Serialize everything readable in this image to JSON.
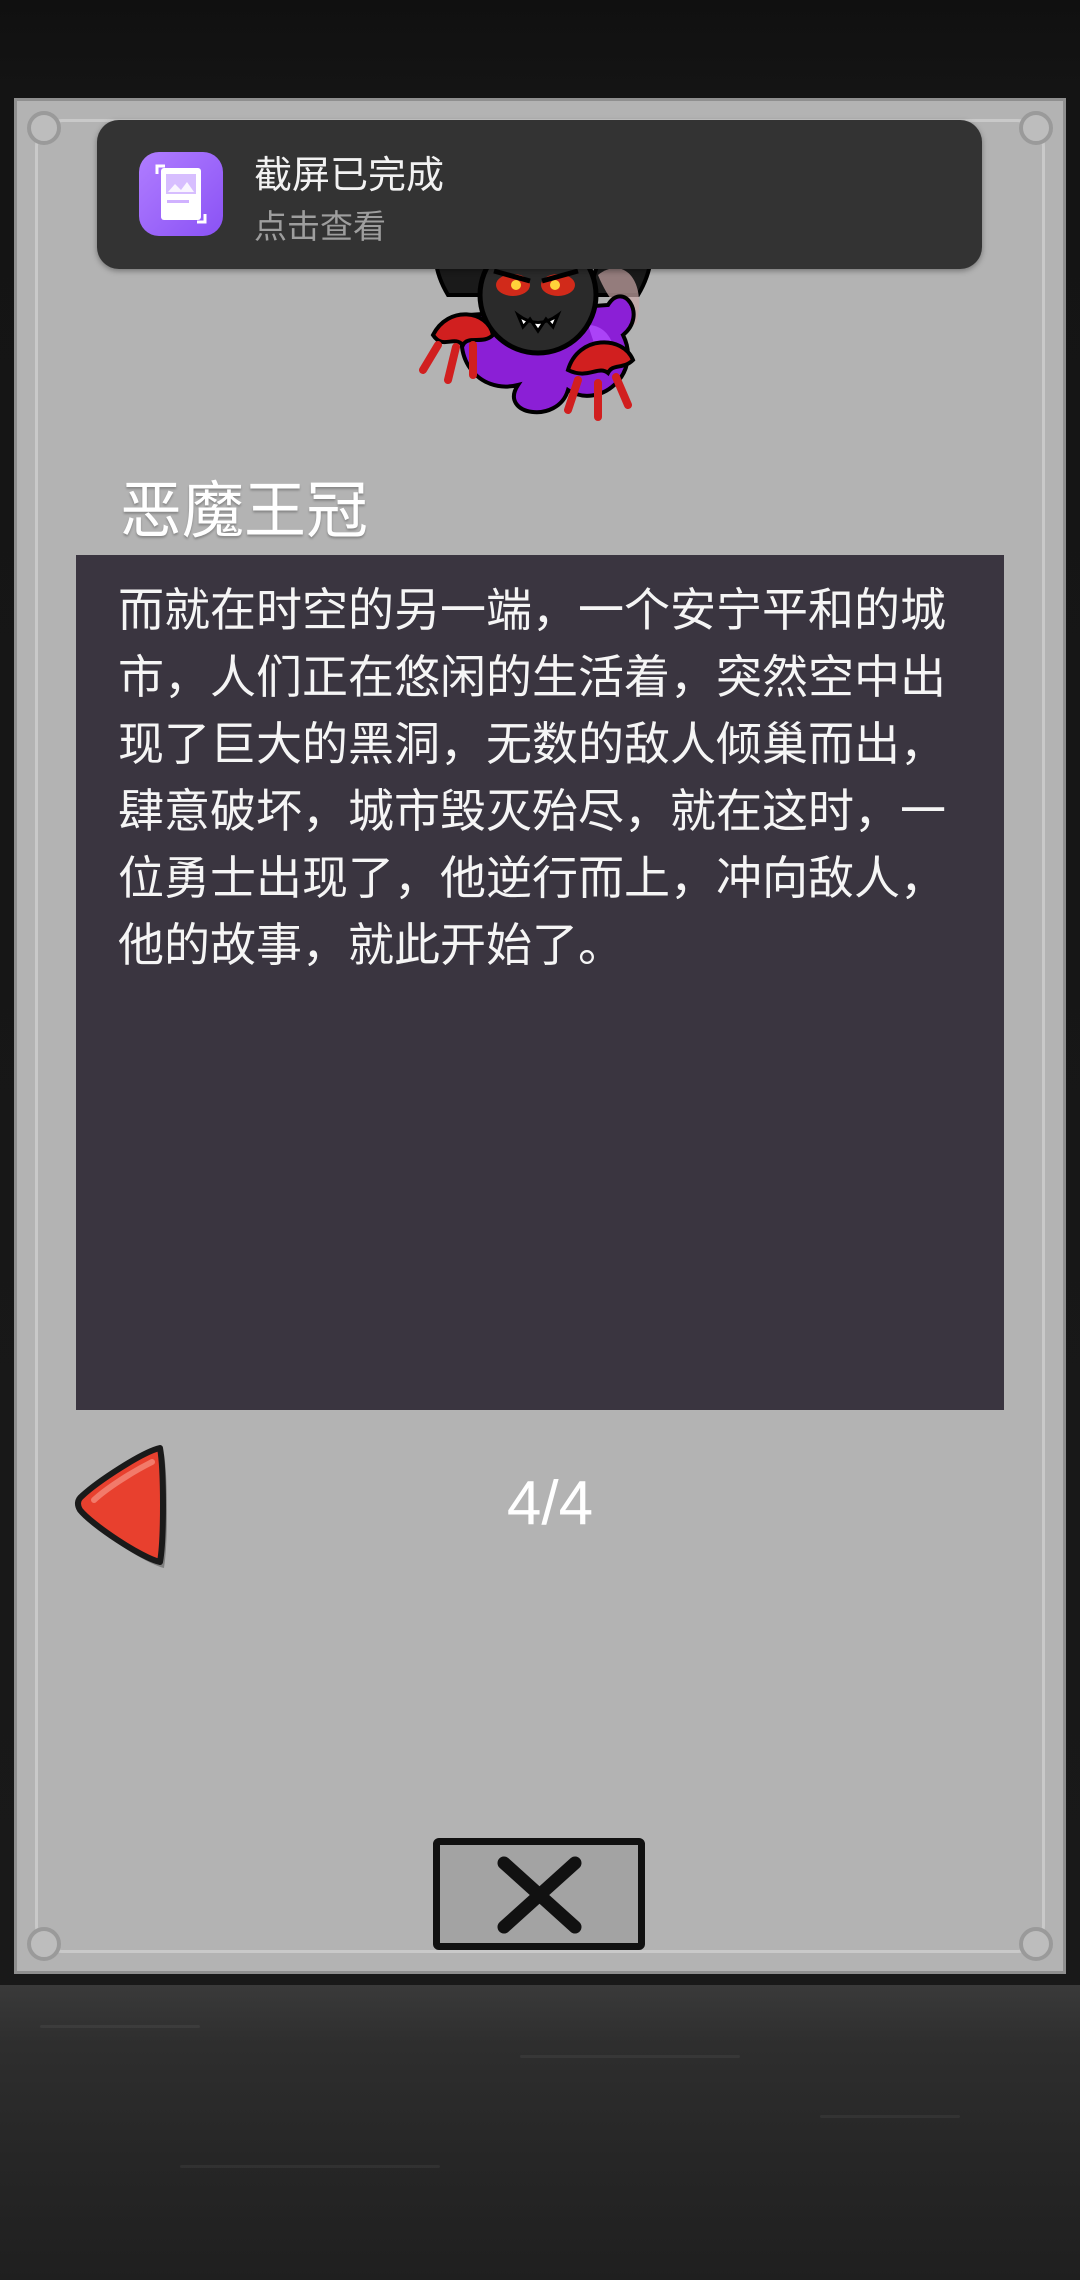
{
  "notification": {
    "title": "截屏已完成",
    "subtitle": "点击查看",
    "icon": "screenshot-icon"
  },
  "item": {
    "name": "恶魔王冠",
    "image": "demon-crown-monster"
  },
  "story": {
    "text": "而就在时空的另一端，一个安宁平和的城市，人们正在悠闲的生活着，突然空中出现了巨大的黑洞，无数的敌人倾巢而出，肆意破坏，城市毁灭殆尽，就在这时，一位勇士出现了，他逆行而上，冲向敌人，他的故事，就此开始了。"
  },
  "pagination": {
    "label": "4/4",
    "prev_icon": "red-left-arrow-icon"
  },
  "close": {
    "icon": "close-x-icon"
  },
  "colors": {
    "panel": "#b3b3b3",
    "story_bg": "#3a3540",
    "toast_bg": "#333333",
    "toast_icon": "#9b66fb",
    "arrow_red": "#e8402e"
  }
}
